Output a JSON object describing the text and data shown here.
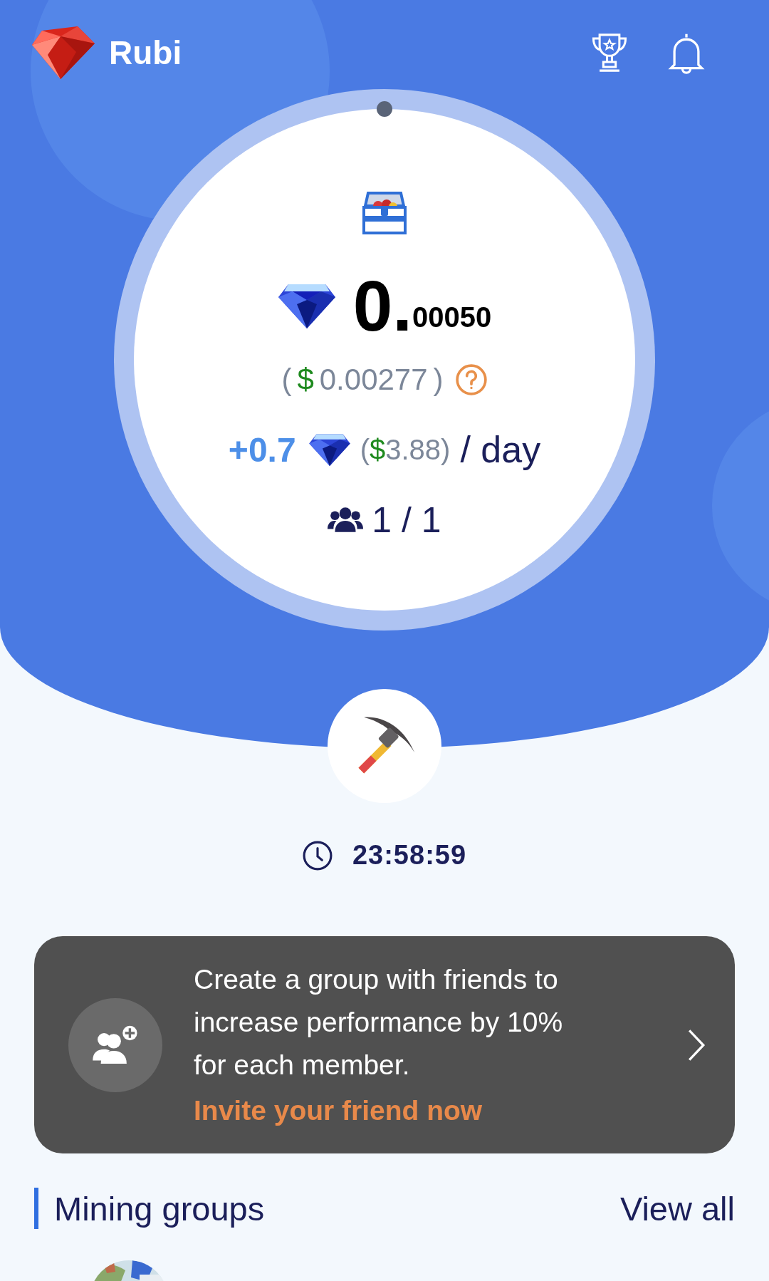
{
  "app": {
    "name": "Rubi"
  },
  "balance": {
    "whole": "0.",
    "fraction": "00050"
  },
  "usd": {
    "open": "(",
    "currency": "$",
    "amount": "0.00277",
    "close": ")"
  },
  "rate": {
    "amount": "+0.7",
    "open": "(",
    "currency": "$",
    "value": "3.88",
    "close": ")",
    "period": "/ day"
  },
  "members": {
    "count": "1 / 1"
  },
  "timer": {
    "time": "23:58:59"
  },
  "invite_card": {
    "text": "Create a group with friends to increase performance by 10% for each member.",
    "link": "Invite your friend now"
  },
  "mining_groups": {
    "title": "Mining groups",
    "view_all": "View all"
  }
}
